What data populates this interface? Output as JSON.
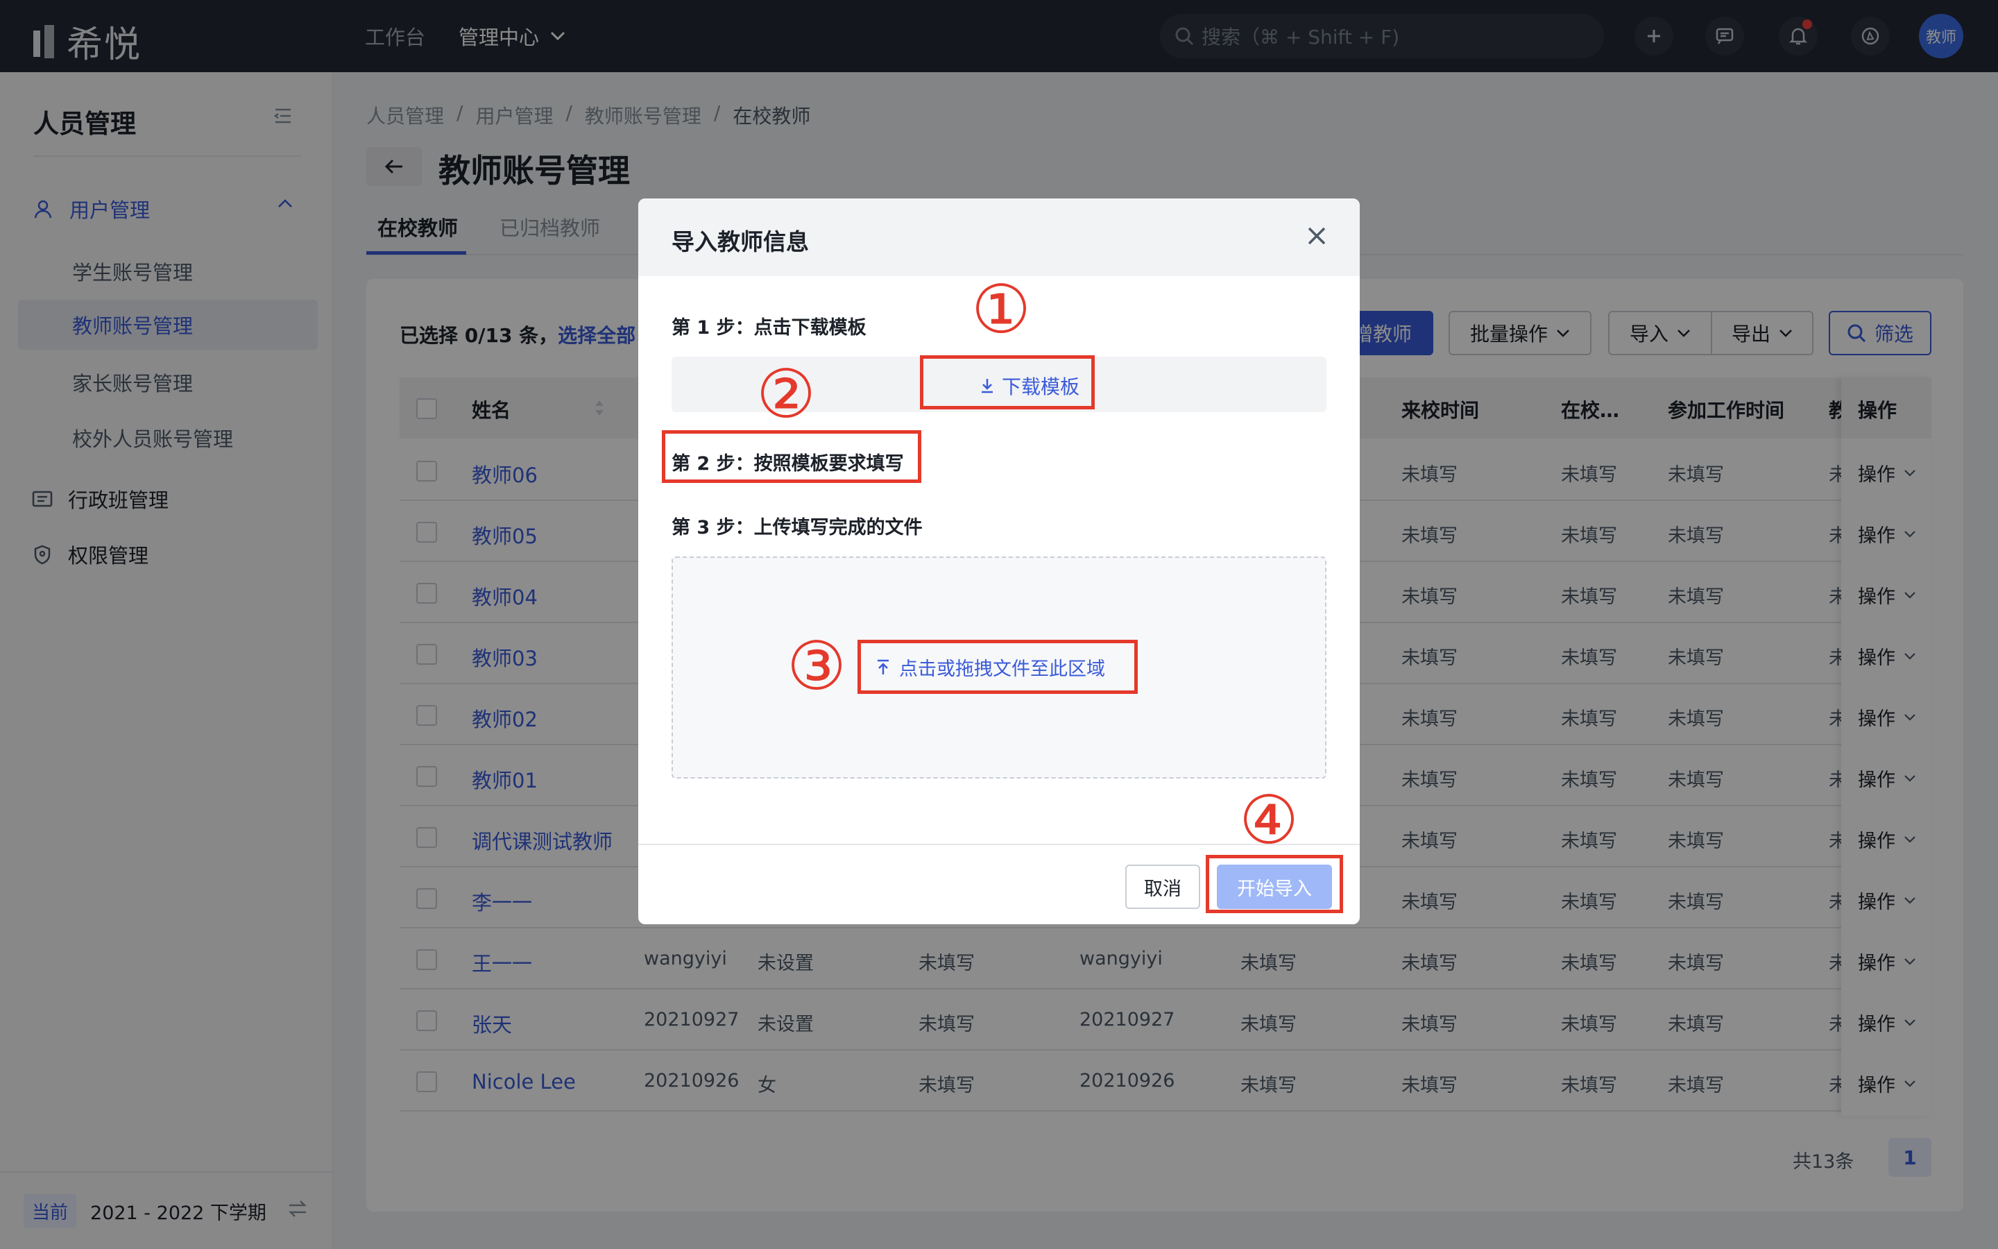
{
  "app": {
    "name": "希悦"
  },
  "topnav": {
    "workbench": "工作台",
    "admin_center": "管理中心"
  },
  "search": {
    "placeholder": "搜索（⌘ + Shift + F)"
  },
  "avatar": {
    "label": "教师"
  },
  "sidebar": {
    "title": "人员管理",
    "group": "用户管理",
    "items": [
      "学生账号管理",
      "教师账号管理",
      "家长账号管理",
      "校外人员账号管理"
    ],
    "admin_class": "行政班管理",
    "permissions": "权限管理",
    "term_badge": "当前",
    "term": "2021 - 2022 下学期"
  },
  "breadcrumb": [
    "人员管理",
    "用户管理",
    "教师账号管理",
    "在校教师"
  ],
  "page": {
    "title": "教师账号管理"
  },
  "tabs": {
    "active": "在校教师",
    "archived": "已归档教师"
  },
  "toolbar": {
    "selection_text": "已选择 0/13 条，",
    "select_all": "选择全部",
    "new_teacher_partial": "增教师",
    "batch": "批量操作",
    "import": "导入",
    "export": "导出",
    "filter": "筛选"
  },
  "table": {
    "headers": {
      "name": "姓名",
      "arrive": "来校时间",
      "atschool": "在校…",
      "work": "参加工作时间",
      "cut": "教",
      "op": "操作"
    },
    "op_label": "操作",
    "rows": [
      {
        "name": "教师06",
        "arrive": "未填写",
        "atschool": "未填写",
        "work": "未填写",
        "cut": "未"
      },
      {
        "name": "教师05",
        "arrive": "未填写",
        "atschool": "未填写",
        "work": "未填写",
        "cut": "未"
      },
      {
        "name": "教师04",
        "arrive": "未填写",
        "atschool": "未填写",
        "work": "未填写",
        "cut": "未"
      },
      {
        "name": "教师03",
        "arrive": "未填写",
        "atschool": "未填写",
        "work": "未填写",
        "cut": "未"
      },
      {
        "name": "教师02",
        "arrive": "未填写",
        "atschool": "未填写",
        "work": "未填写",
        "cut": "未"
      },
      {
        "name": "教师01",
        "arrive": "未填写",
        "atschool": "未填写",
        "work": "未填写",
        "cut": "未"
      },
      {
        "name": "调代课测试教师",
        "arrive": "未填写",
        "atschool": "未填写",
        "work": "未填写",
        "cut": "未"
      },
      {
        "name": "李一一",
        "arrive": "未填写",
        "atschool": "未填写",
        "work": "未填写",
        "cut": "未"
      },
      {
        "name": "王一一",
        "c1": "wangyiyi",
        "c2": "未设置",
        "c3": "未填写",
        "c4": "wangyiyi",
        "c5": "未填写",
        "arrive": "未填写",
        "atschool": "未填写",
        "work": "未填写",
        "cut": "未"
      },
      {
        "name": "张天",
        "c1": "20210927",
        "c2": "未设置",
        "c3": "未填写",
        "c4": "20210927",
        "c5": "未填写",
        "arrive": "未填写",
        "atschool": "未填写",
        "work": "未填写",
        "cut": "未"
      },
      {
        "name": "Nicole Lee",
        "c1": "20210926",
        "c2": "女",
        "c3": "未填写",
        "c4": "20210926",
        "c5": "未填写",
        "arrive": "未填写",
        "atschool": "未填写",
        "work": "未填写",
        "cut": "未"
      }
    ]
  },
  "pagination": {
    "total": "共13条",
    "page": "1"
  },
  "modal": {
    "title": "导入教师信息",
    "step1": "第 1 步：点击下载模板",
    "download": "下载模板",
    "step2": "第 2 步：按照模板要求填写",
    "step3": "第 3 步：上传填写完成的文件",
    "upload": "点击或拖拽文件至此区域",
    "cancel": "取消",
    "start": "开始导入"
  },
  "annotations": [
    "①",
    "②",
    "③",
    "④"
  ],
  "colors": {
    "primary": "#3a5bd9",
    "topbar": "#232833",
    "annotation": "#e4392b"
  }
}
